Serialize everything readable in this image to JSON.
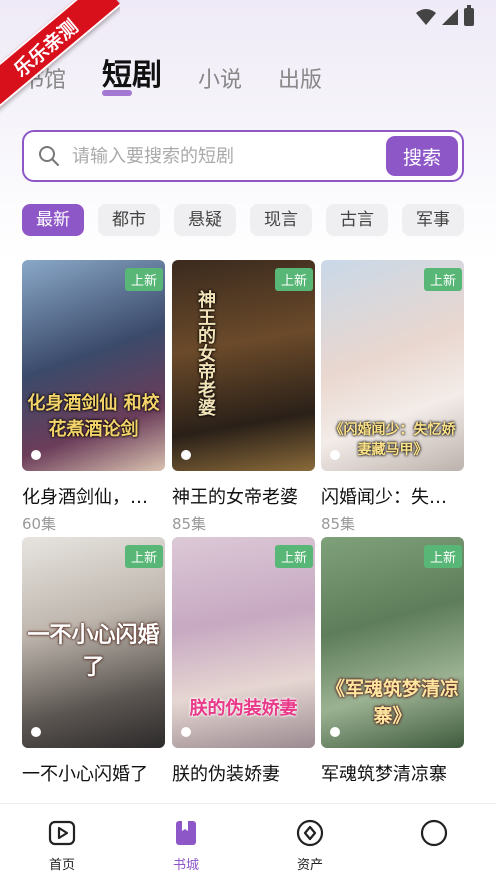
{
  "corner_ribbon": "乐乐亲测",
  "top_tabs": [
    {
      "label": "书馆",
      "active": false
    },
    {
      "label": "短剧",
      "active": true
    },
    {
      "label": "小说",
      "active": false
    },
    {
      "label": "出版",
      "active": false
    }
  ],
  "search": {
    "placeholder": "请输入要搜索的短剧",
    "button_label": "搜索"
  },
  "genres": [
    "最新",
    "都市",
    "悬疑",
    "现言",
    "古言",
    "军事"
  ],
  "active_genre": "最新",
  "dramas": [
    {
      "title": "化身酒剑仙，…",
      "count": "60集",
      "badge": "上新",
      "poster_text": "化身酒剑仙 和校花煮酒论剑"
    },
    {
      "title": "神王的女帝老婆",
      "count": "85集",
      "badge": "上新",
      "poster_text": "神王的女帝老婆"
    },
    {
      "title": "闪婚闻少：失…",
      "count": "85集",
      "badge": "上新",
      "poster_text": "《闪婚闻少：失忆娇妻藏马甲》"
    },
    {
      "title": "一不小心闪婚了",
      "count": "",
      "badge": "上新",
      "poster_text": "一不小心闪婚了"
    },
    {
      "title": "朕的伪装娇妻",
      "count": "",
      "badge": "上新",
      "poster_text": "朕的伪装娇妻"
    },
    {
      "title": "军魂筑梦清凉寨",
      "count": "",
      "badge": "上新",
      "poster_text": "《军魂筑梦清凉寨》"
    }
  ],
  "bottom_nav": [
    {
      "label": "首页",
      "icon": "play-icon",
      "active": false
    },
    {
      "label": "书城",
      "icon": "book-icon",
      "active": true
    },
    {
      "label": "资产",
      "icon": "diamond-icon",
      "active": false
    },
    {
      "label": "",
      "icon": "profile-icon",
      "active": false
    }
  ],
  "colors": {
    "accent": "#8e57c8",
    "badge": "#58b776",
    "ribbon": "#d8101c"
  }
}
